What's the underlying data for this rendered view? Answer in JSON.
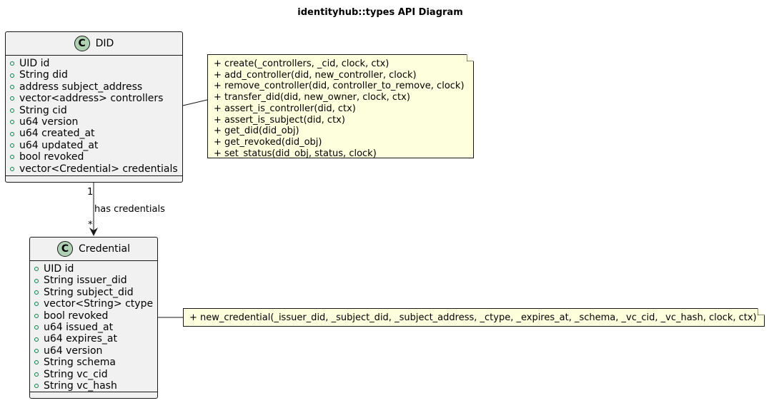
{
  "title": "identityhub::types API Diagram",
  "classes": {
    "did": {
      "name": "DID",
      "stereotype_icon": "C",
      "attributes": [
        "UID id",
        "String did",
        "address subject_address",
        "vector<address> controllers",
        "String cid",
        "u64 version",
        "u64 created_at",
        "u64 updated_at",
        "bool revoked",
        "vector<Credential> credentials"
      ]
    },
    "credential": {
      "name": "Credential",
      "stereotype_icon": "C",
      "attributes": [
        "UID id",
        "String issuer_did",
        "String subject_did",
        "vector<String> ctype",
        "bool revoked",
        "u64 issued_at",
        "u64 expires_at",
        "u64 version",
        "String schema",
        "String vc_cid",
        "String vc_hash"
      ]
    }
  },
  "notes": {
    "did": [
      "+ create(_controllers, _cid, clock, ctx)",
      "+ add_controller(did, new_controller, clock)",
      "+ remove_controller(did, controller_to_remove, clock)",
      "+ transfer_did(did, new_owner, clock, ctx)",
      "+ assert_is_controller(did, ctx)",
      "+ assert_is_subject(did, ctx)",
      "+ get_did(did_obj)",
      "+ get_revoked(did_obj)",
      "+ set_status(did_obj, status, clock)"
    ],
    "credential": [
      "+ new_credential(_issuer_did, _subject_did, _subject_address, _ctype, _expires_at, _schema, _vc_cid, _vc_hash, clock, ctx)"
    ]
  },
  "relation": {
    "label": "has credentials",
    "source_multiplicity": "1",
    "target_multiplicity": "*"
  },
  "colors": {
    "class_fill": "#f1f1f1",
    "badge_fill": "#add1b2",
    "note_fill": "#feffdd",
    "visibility_public": "#038048",
    "line": "#181818"
  }
}
